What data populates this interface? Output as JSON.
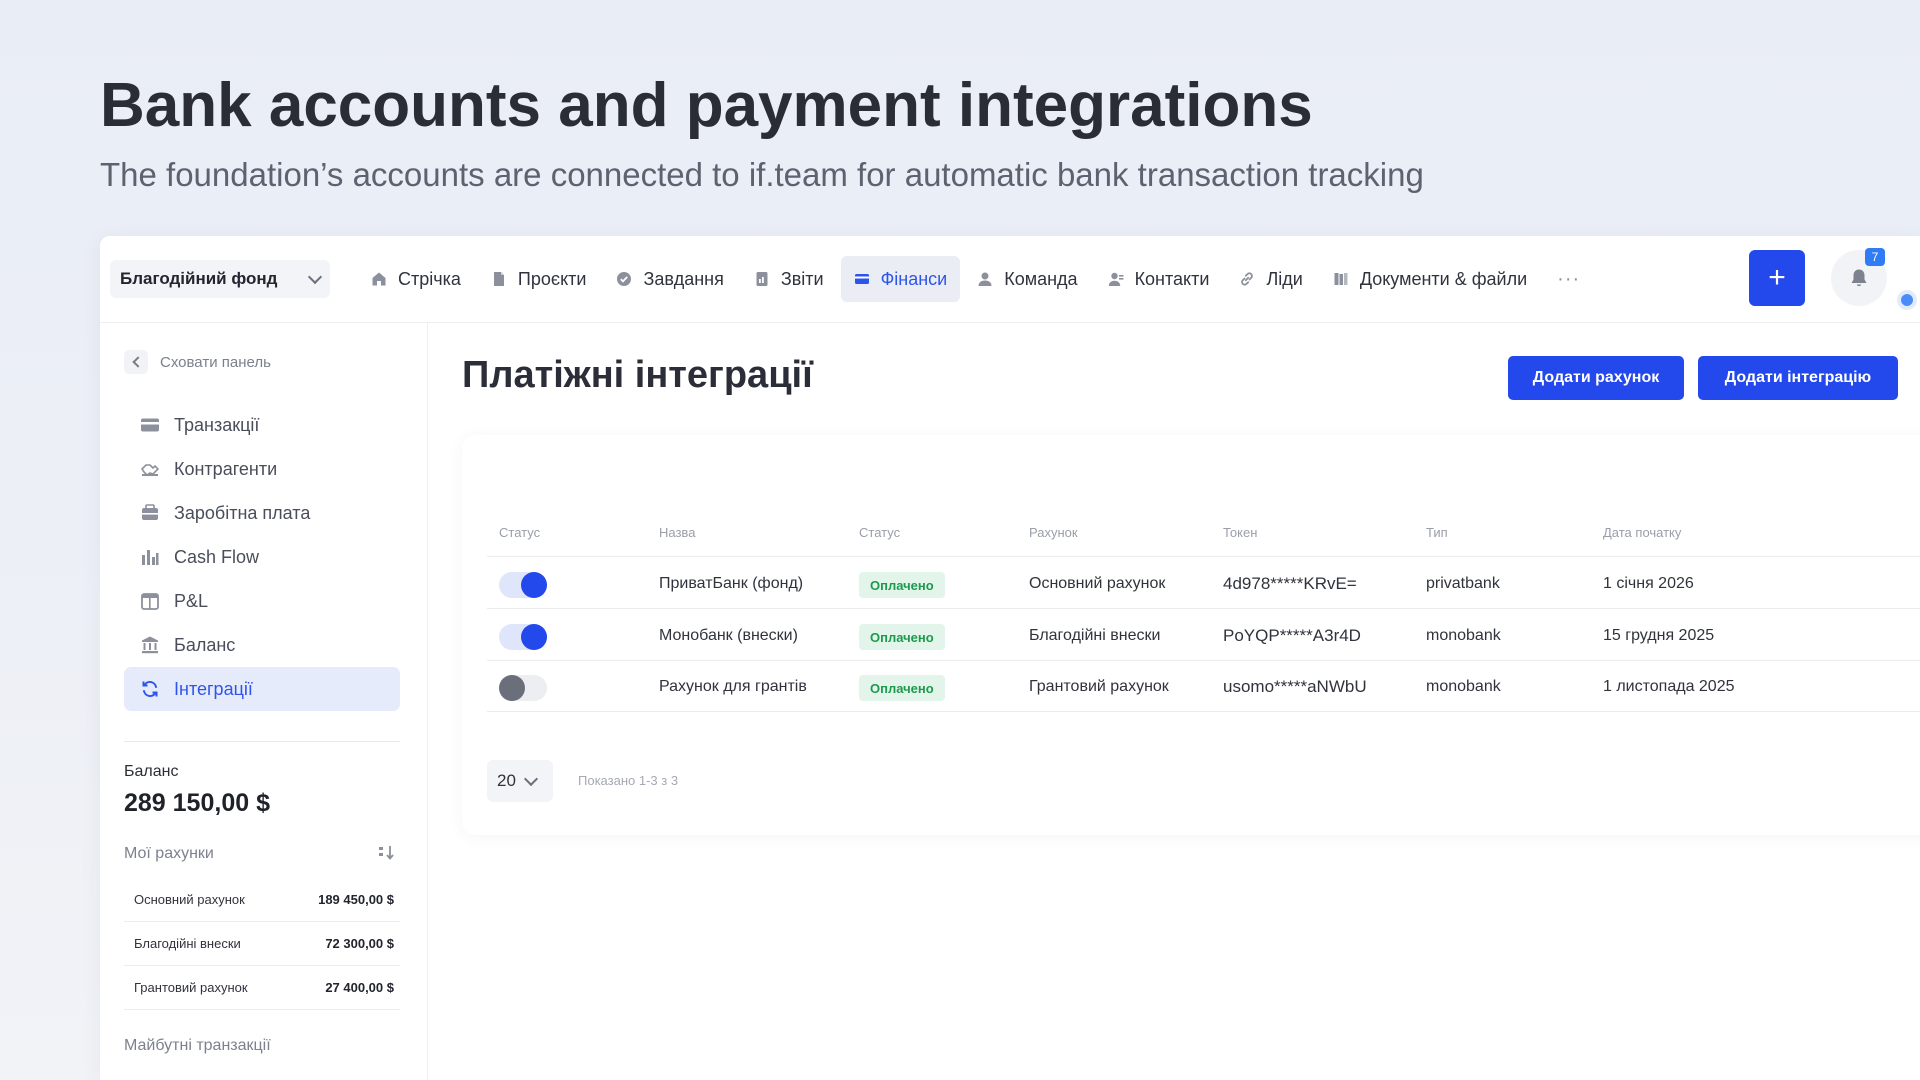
{
  "hero": {
    "title": "Bank accounts and payment integrations",
    "subtitle": "The foundation’s accounts are connected to if.team for automatic bank transaction tracking"
  },
  "topbar": {
    "org": "Благодійний фонд",
    "nav": [
      {
        "label": "Стрічка",
        "icon": "home-icon"
      },
      {
        "label": "Проєкти",
        "icon": "file-icon"
      },
      {
        "label": "Завдання",
        "icon": "check-circle-icon"
      },
      {
        "label": "Звіти",
        "icon": "report-icon"
      },
      {
        "label": "Фінанси",
        "icon": "card-icon"
      },
      {
        "label": "Команда",
        "icon": "user-icon"
      },
      {
        "label": "Контакти",
        "icon": "contacts-icon"
      },
      {
        "label": "Ліди",
        "icon": "link-icon"
      },
      {
        "label": "Документи & файли",
        "icon": "books-icon"
      }
    ],
    "more": "···",
    "add": "+",
    "notifications": "7",
    "colors": {
      "accent": "#2348eb",
      "active_bg": "#eaedf4"
    }
  },
  "sidebar": {
    "collapse": "Сховати панель",
    "items": [
      {
        "label": "Транзакції",
        "icon": "card-icon"
      },
      {
        "label": "Контрагенти",
        "icon": "handshake-icon"
      },
      {
        "label": "Заробітна плата",
        "icon": "wallet-icon"
      },
      {
        "label": "Cash Flow",
        "icon": "bar-chart-icon"
      },
      {
        "label": "P&L",
        "icon": "calendar-icon"
      },
      {
        "label": "Баланс",
        "icon": "bank-icon"
      },
      {
        "label": "Інтеграції",
        "icon": "sync-icon"
      }
    ],
    "balance_label": "Баланс",
    "balance_value": "289 150,00 $",
    "accounts_title": "Мої рахунки",
    "accounts": [
      {
        "name": "Основний рахунок",
        "value": "189 450,00 $"
      },
      {
        "name": "Благодійні внески",
        "value": "72 300,00 $"
      },
      {
        "name": "Грантовий рахунок",
        "value": "27 400,00 $"
      }
    ],
    "future": "Майбутні транзакції"
  },
  "main": {
    "title": "Платіжні інтеграції",
    "add_account": "Додати рахунок",
    "add_integration": "Додати інтеграцію",
    "headers": [
      "Статус",
      "Назва",
      "Статус",
      "Рахунок",
      "Токен",
      "Тип",
      "Дата початку"
    ],
    "rows": [
      {
        "enabled": true,
        "name": "ПриватБанк (фонд)",
        "status": "Оплачено",
        "account": "Основний рахунок",
        "token": "4d978*****KRvE=",
        "type": "privatbank",
        "date": "1 січня 2026"
      },
      {
        "enabled": true,
        "name": "Монобанк (внески)",
        "status": "Оплачено",
        "account": "Благодійні внески",
        "token": "PoYQP*****A3r4D",
        "type": "monobank",
        "date": "15 грудня 2025"
      },
      {
        "enabled": false,
        "name": "Рахунок для грантів",
        "status": "Оплачено",
        "account": "Грантовий рахунок",
        "token": "usomo*****aNWbU",
        "type": "monobank",
        "date": "1 листопада 2025"
      }
    ],
    "page_size": "20",
    "shown": "Показано 1-3 з 3"
  }
}
